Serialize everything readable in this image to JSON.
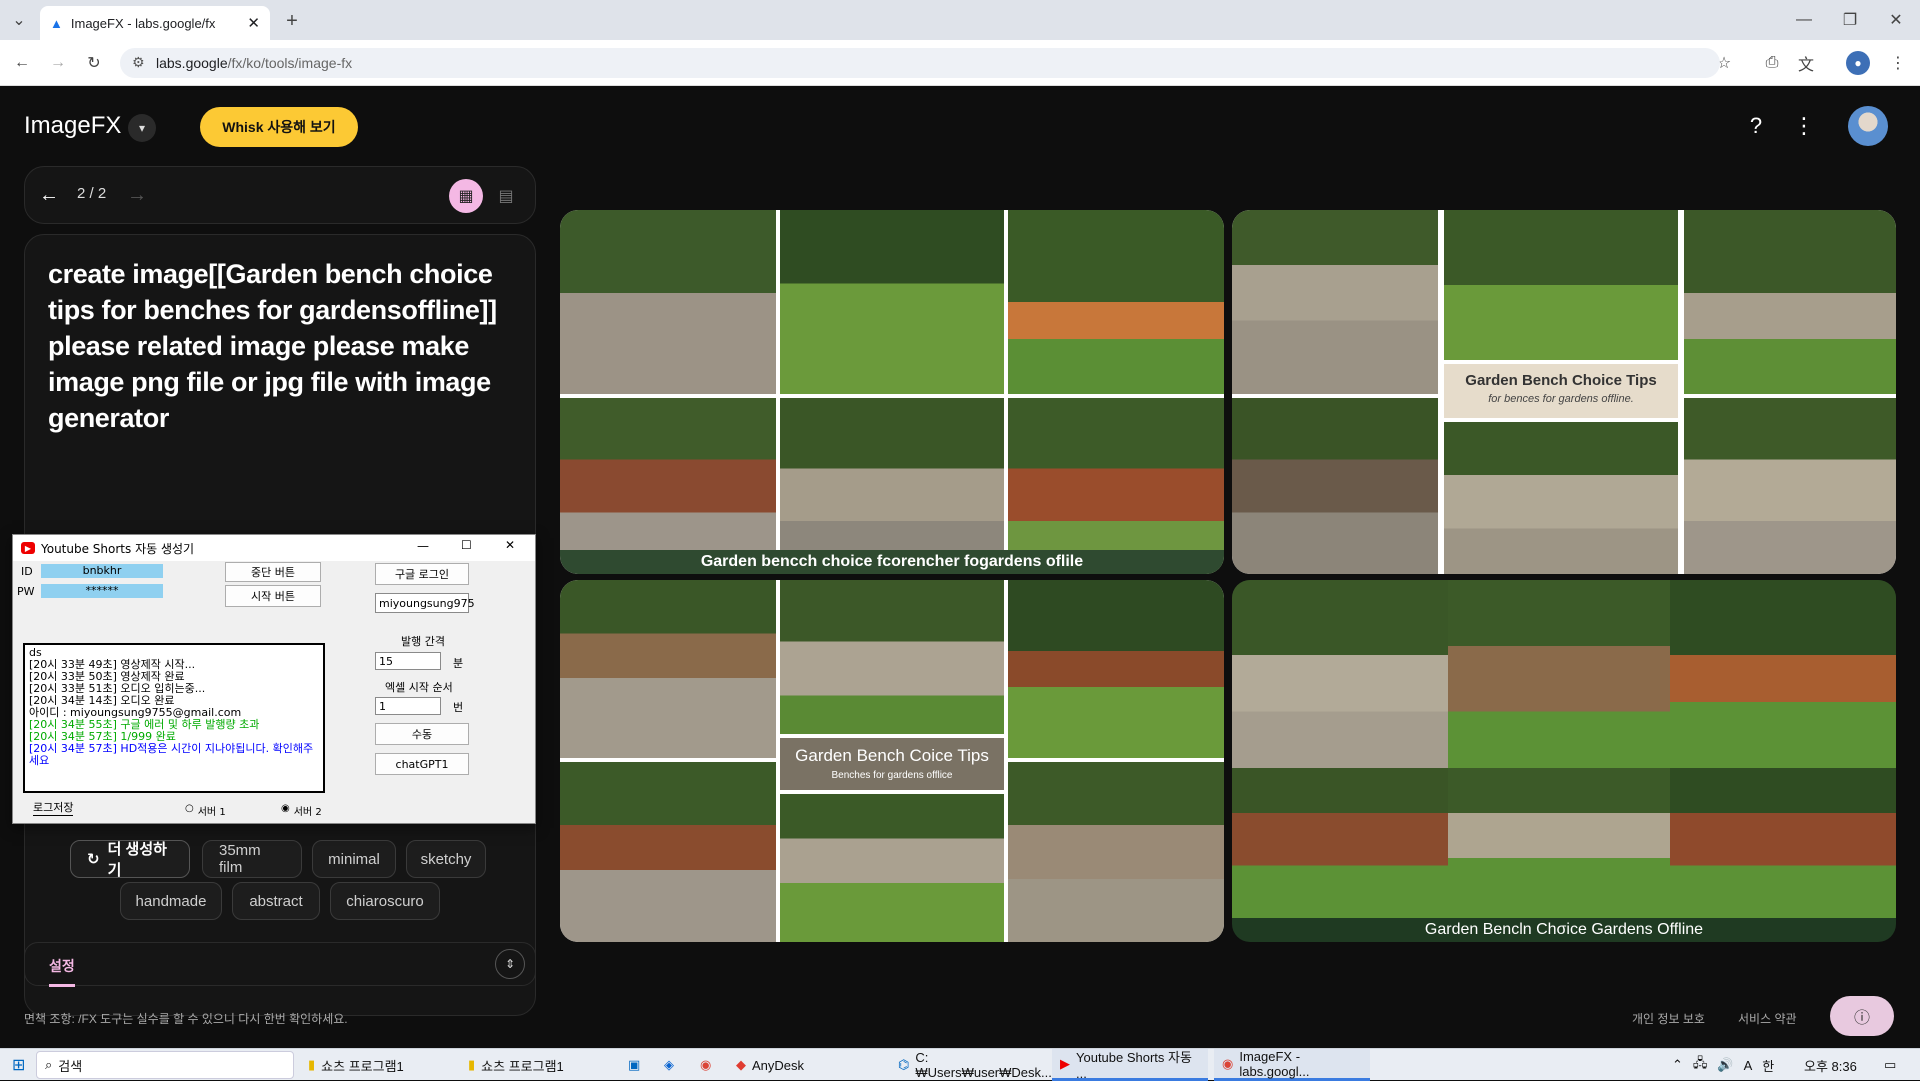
{
  "browser": {
    "tab_title": "ImageFX - labs.google/fx",
    "url_host": "labs.google",
    "url_path": "/fx/ko/tools/image-fx"
  },
  "app": {
    "name": "ImageFX",
    "whisk_button": "Whisk 사용해 보기",
    "pager": "2 / 2",
    "prompt": "create image[[Garden bench choice tips for benches for gardensoffline]] please related image please make image png file or jpg file with image generator",
    "generate_button": "더 생성하기",
    "chips": [
      "35mm film",
      "minimal",
      "sketchy",
      "handmade",
      "abstract",
      "chiaroscuro"
    ],
    "settings_tab": "설정",
    "disclaimer": "면책 조항: /FX 도구는 실수를 할 수 있으니 다시 한번 확인하세요.",
    "privacy": "개인 정보 보호",
    "terms": "서비스 약관"
  },
  "images": {
    "caption1": "Garden bencch choice fcorencher fogardens oflile",
    "card2_title": "Garden Bench Choice Tips",
    "card2_sub": "for bences for gardens offline.",
    "card3_title": "Garden Bench Coice Tips",
    "card3_sub": "Benches for gardens offlice",
    "caption4": "Garden Bencln Chσice Gardens Offline"
  },
  "dialog": {
    "title": "Youtube Shorts 자동 생성기",
    "id_label": "ID",
    "id_value": "bnbkhr",
    "pw_label": "PW",
    "pw_value": "******",
    "stop_btn": "중단 버튼",
    "start_btn": "시작 버튼",
    "google_login": "구글 로그인",
    "email_field": "miyoungsung975",
    "interval_label": "발행 간격",
    "interval_value": "15",
    "interval_unit": "분",
    "excel_label": "엑셀 시작 순서",
    "excel_value": "1",
    "excel_unit": "번",
    "manual_btn": "수동",
    "gpt_btn": "chatGPT1",
    "log": [
      "ds",
      "[20시 33분 49초] 영상제작 시작...",
      "[20시 33분 50초] 영상제작 완료",
      "[20시 33분 51초] 오디오 입히는중...",
      "[20시 34분 14초] 오디오 완료",
      "아이디 : miyoungsung9755@gmail.com",
      "[20시 34분 55초] 구글 에러 및 하루 발행량 초과",
      "[20시 34분 57초] 1/999 완료",
      "[20시 34분 57초] HD적용은 시간이 지나야됩니다. 확인해주세요"
    ],
    "log_save": "로그저장",
    "server1": "서버 1",
    "server2": "서버 2"
  },
  "taskbar": {
    "search": "검색",
    "items": [
      "쇼츠 프로그램1",
      "쇼츠 프로그램1",
      "AnyDesk",
      "C:₩Users₩user₩Desk...",
      "Youtube Shorts 자동 ...",
      "ImageFX - labs.googl..."
    ],
    "time": "오후 8:36"
  },
  "colors": {
    "whisk": "#fcc934",
    "accent_pink": "#f4b8e4",
    "bg": "#0e0e0e"
  }
}
